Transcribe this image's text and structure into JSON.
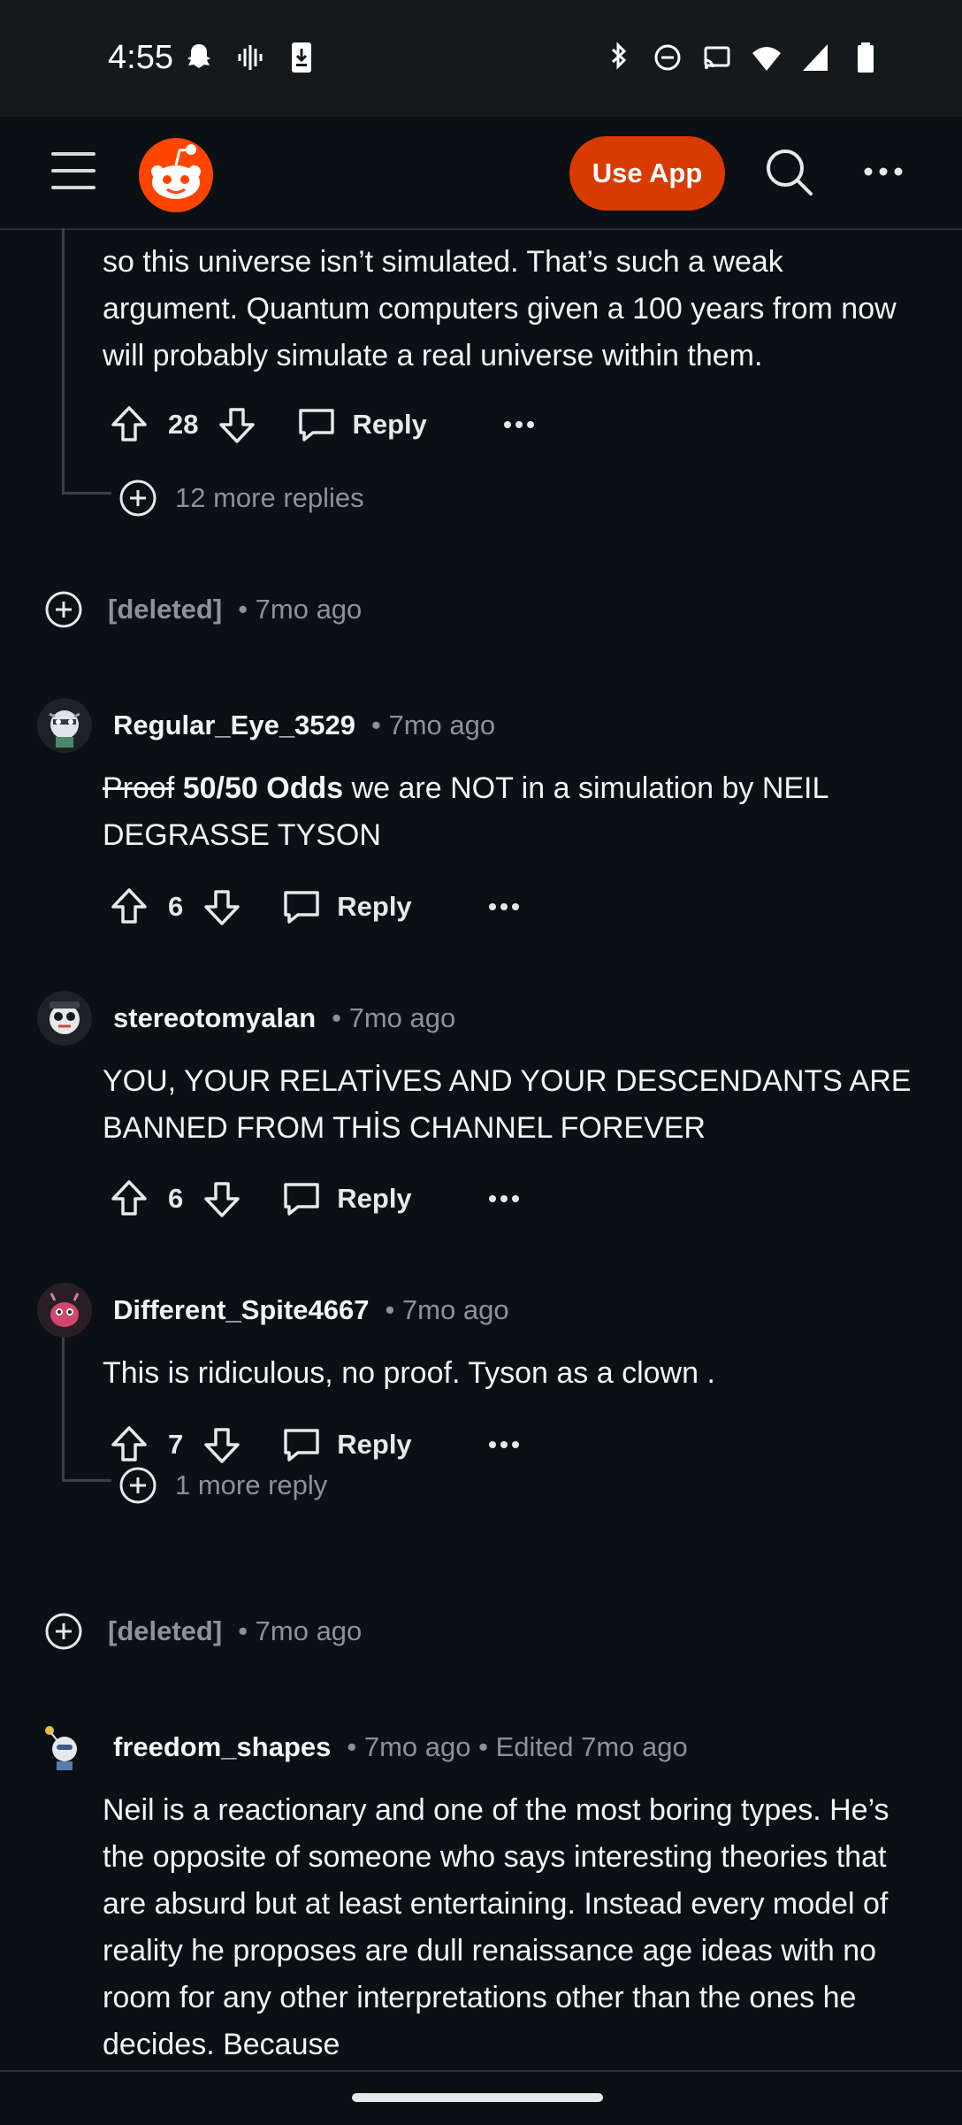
{
  "status": {
    "time": "4:55"
  },
  "appbar": {
    "use_app": "Use App"
  },
  "comments": {
    "c0": {
      "text": "so this universe isn’t simulated. That’s such a weak argument. Quantum computers given a 100 years from now will probably simulate a real universe within them.",
      "votes": "28",
      "reply": "Reply",
      "more_replies": "12 more replies"
    },
    "deleted1": {
      "label": "[deleted]",
      "time": "• 7mo ago"
    },
    "c1": {
      "user": "Regular_Eye_3529",
      "time": "• 7mo ago",
      "text_strike": "Proof",
      "text_bold": "50/50 Odds",
      "text_rest": " we are NOT in a simulation by NEIL DEGRASSE TYSON",
      "votes": "6",
      "reply": "Reply"
    },
    "c2": {
      "user": "stereotomyalan",
      "time": "• 7mo ago",
      "text": "YOU, YOUR RELATİVES AND YOUR DESCENDANTS ARE BANNED FROM THİS CHANNEL FOREVER",
      "votes": "6",
      "reply": "Reply"
    },
    "c3": {
      "user": "Different_Spite4667",
      "time": "• 7mo ago",
      "text": "This is ridiculous, no proof. Tyson as a clown .",
      "votes": "7",
      "reply": "Reply",
      "more_replies": "1 more reply"
    },
    "deleted2": {
      "label": "[deleted]",
      "time": "• 7mo ago"
    },
    "c4": {
      "user": "freedom_shapes",
      "time": "• 7mo ago • Edited 7mo ago",
      "text": "Neil is a reactionary and one of the most boring types. He’s the opposite of someone who says interesting theories that are absurd but at least entertaining. Instead every model of reality he proposes are dull renaissance age ideas with no room for any other interpretations other than the ones he decides. Because"
    }
  },
  "colors": {
    "background": "#0b1014",
    "accent": "#d93a00",
    "muted": "#8b9298"
  }
}
